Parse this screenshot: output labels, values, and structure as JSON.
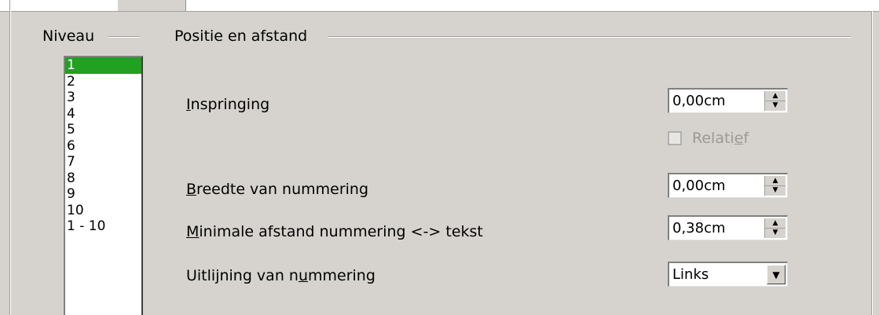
{
  "niveau": {
    "title": "Niveau",
    "items": [
      "1",
      "2",
      "3",
      "4",
      "5",
      "6",
      "7",
      "8",
      "9",
      "10",
      "1 - 10"
    ],
    "selected": "1"
  },
  "positie": {
    "title": "Positie en afstand",
    "inspringing": {
      "label_pre": "",
      "label_u": "I",
      "label_post": "nspringing",
      "value": "0,00cm"
    },
    "relatief": {
      "label_pre": "Relati",
      "label_u": "e",
      "label_post": "f",
      "checked": false,
      "enabled": false
    },
    "breedte": {
      "label_pre": "",
      "label_u": "B",
      "label_post": "reedte van nummering",
      "value": "0,00cm"
    },
    "minimale": {
      "label_pre": "",
      "label_u": "M",
      "label_post": "inimale afstand nummering <-> tekst",
      "value": "0,38cm"
    },
    "uitlijning": {
      "label_pre": "Uitlijning van n",
      "label_u": "u",
      "label_post": "mmering",
      "value": "Links"
    }
  }
}
